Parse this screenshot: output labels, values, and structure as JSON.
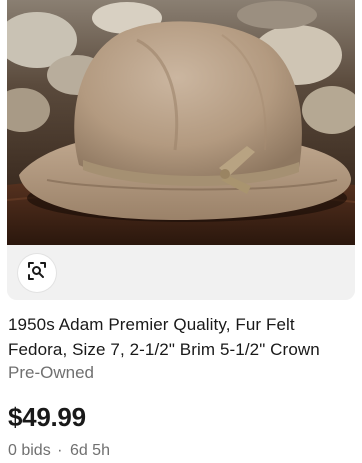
{
  "listing": {
    "title_line1": "1950s Adam Premier Quality, Fur Felt",
    "title_line2": "Fedora, Size 7, 2-1/2\" Brim 5-1/2\" Crown",
    "condition": "Pre-Owned",
    "price": "$49.99",
    "bids": "0 bids",
    "separator": "·",
    "time_left": "6d 5h",
    "image_alt": "Tan fur felt fedora hat with ribbon band on wooden surface"
  },
  "icons": {
    "visual_search": "visual-search-icon"
  },
  "colors": {
    "text_primary": "#191919",
    "text_secondary": "#707070",
    "media_footer_bg": "#f1f1f1",
    "hat_felt": "#b49c82",
    "background_dark": "#2b1c14"
  }
}
